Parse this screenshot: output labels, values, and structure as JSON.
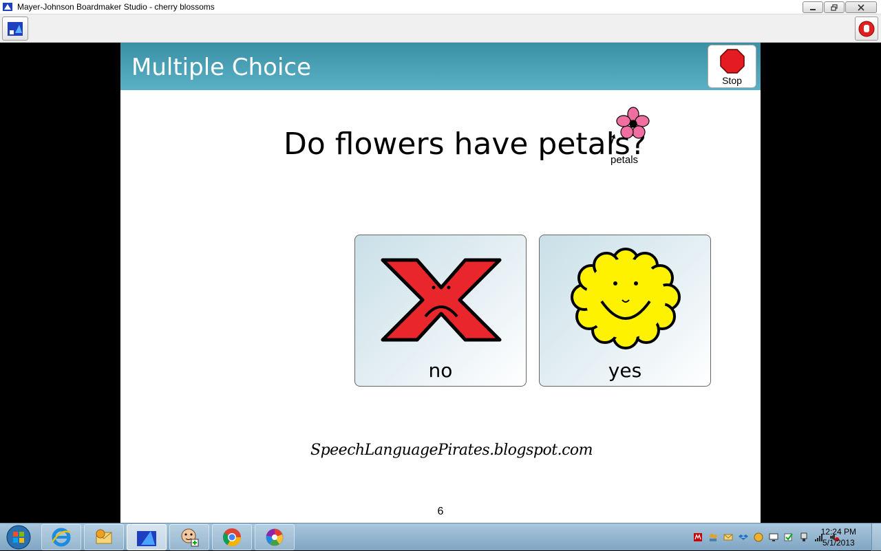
{
  "window": {
    "title": "Mayer-Johnson Boardmaker Studio - cherry blossoms"
  },
  "slide": {
    "header_title": "Multiple Choice",
    "stop_label": "Stop",
    "question": "Do flowers have petals?",
    "question_symbol_label": "petals",
    "choices": [
      {
        "label": "no",
        "icon": "frowning-x-icon"
      },
      {
        "label": "yes",
        "icon": "smiling-sun-icon"
      }
    ],
    "credit": "SpeechLanguagePirates.blogspot.com",
    "page_number": "6"
  },
  "taskbar": {
    "items": [
      "internet-explorer-icon",
      "outlook-icon",
      "boardmaker-icon",
      "speaking-dynamically-icon",
      "chrome-icon",
      "picasa-icon"
    ],
    "active_item": "boardmaker-icon",
    "clock_time": "12:24 PM",
    "clock_date": "5/1/2013"
  },
  "colors": {
    "header_band": "#4ea3b8",
    "stop_red": "#e41b23",
    "no_red": "#e8262b",
    "yes_yellow": "#fff200"
  }
}
